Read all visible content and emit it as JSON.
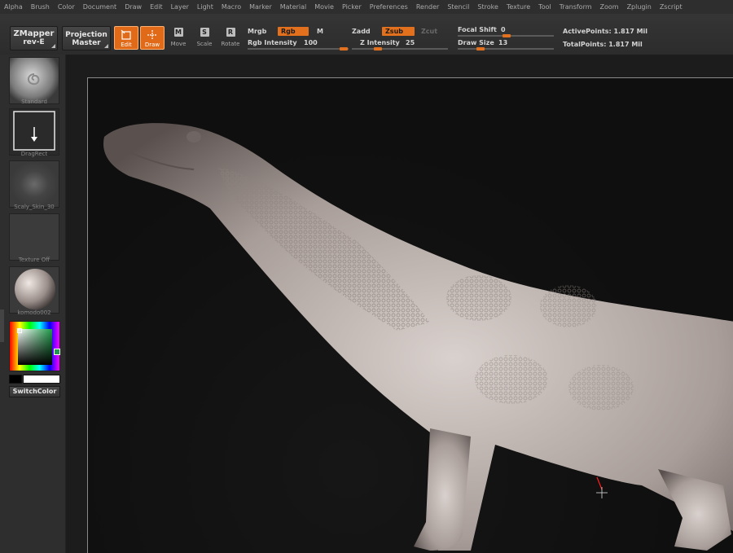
{
  "menu": [
    "Alpha",
    "Brush",
    "Color",
    "Document",
    "Draw",
    "Edit",
    "Layer",
    "Light",
    "Macro",
    "Marker",
    "Material",
    "Movie",
    "Picker",
    "Preferences",
    "Render",
    "Stencil",
    "Stroke",
    "Texture",
    "Tool",
    "Transform",
    "Zoom",
    "Zplugin",
    "Zscript"
  ],
  "toolbar": {
    "zmapper": {
      "line1": "ZMapper",
      "line2": "rev-E"
    },
    "projection": {
      "line1": "Projection",
      "line2": "Master"
    },
    "tools": [
      {
        "label": "Edit",
        "icon": "edit-icon",
        "active": true
      },
      {
        "label": "Draw",
        "icon": "draw-icon",
        "active": true
      },
      {
        "label": "Move",
        "key": "M",
        "active": false
      },
      {
        "label": "Scale",
        "key": "S",
        "active": false
      },
      {
        "label": "Rotate",
        "key": "R",
        "active": false
      }
    ],
    "mrgb": "Mrgb",
    "rgb": "Rgb",
    "m": "M",
    "rgb_intensity_label": "Rgb  Intensity",
    "rgb_intensity": "100",
    "zadd": "Zadd",
    "zsub": "Zsub",
    "zcut": "Zcut",
    "z_intensity_label": "Z  Intensity",
    "z_intensity": "25",
    "focal_shift_label": "Focal  Shift",
    "focal_shift": "0",
    "draw_size_label": "Draw  Size",
    "draw_size": "13",
    "active_points": "ActivePoints: 1.817  Mil",
    "total_points": "TotalPoints: 1.817  Mil",
    "accent_color": "#e3701c"
  },
  "shelf": {
    "brush": "Standard",
    "stroke": "DragRect",
    "alpha": "Scaly_Skin_30",
    "texture": "Texture  Off",
    "material": "komodo002",
    "switch_color": "SwitchColor",
    "main_color": "#000000",
    "secondary_color": "#ffffff"
  }
}
